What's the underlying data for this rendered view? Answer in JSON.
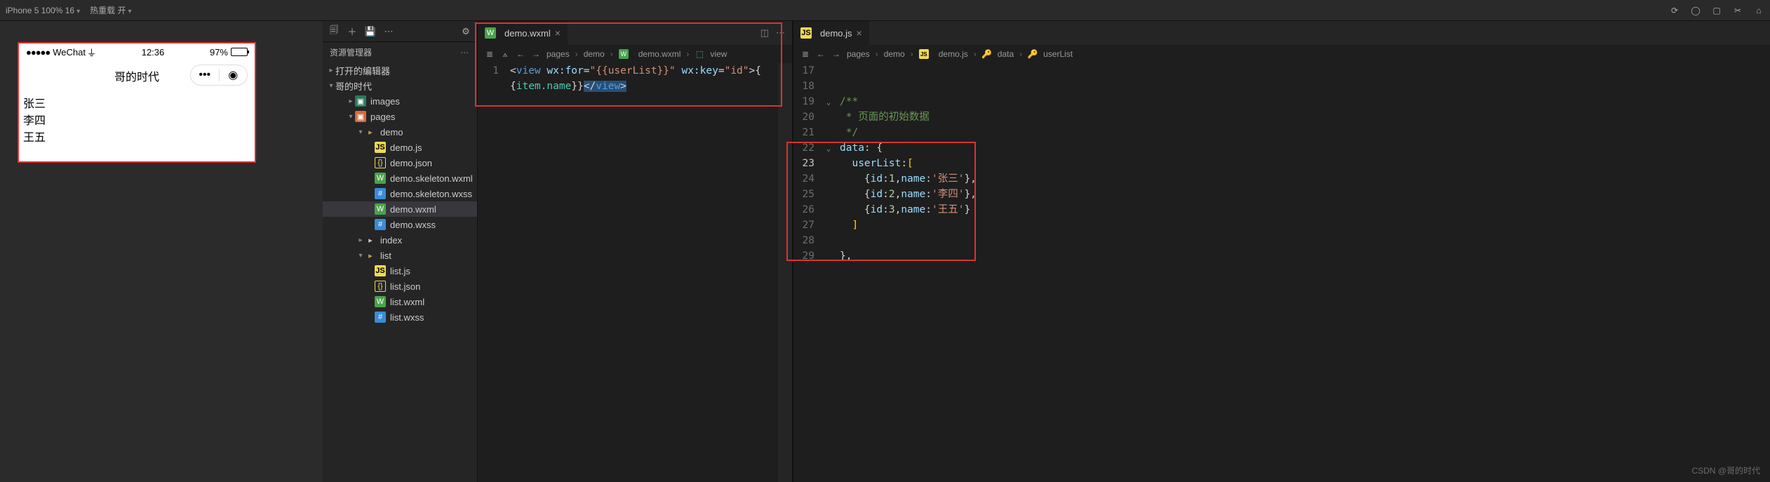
{
  "toolbar": {
    "device": "iPhone 5 100% 16",
    "reload": "热重载 开"
  },
  "simulator": {
    "status_time": "12:36",
    "signal_label": "WeChat",
    "battery_pct": "97%",
    "nav_title": "哥的时代",
    "list": [
      "张三",
      "李四",
      "王五"
    ]
  },
  "explorer": {
    "title": "资源管理器",
    "sections": {
      "open_editors": "打开的编辑器",
      "project": "哥的时代"
    },
    "tree": [
      {
        "name": "images",
        "type": "img",
        "depth": 2,
        "tw": "▸"
      },
      {
        "name": "pages",
        "type": "pages",
        "depth": 2,
        "tw": "▾"
      },
      {
        "name": "demo",
        "type": "dir",
        "depth": 3,
        "tw": "▾"
      },
      {
        "name": "demo.js",
        "type": "js",
        "depth": 4
      },
      {
        "name": "demo.json",
        "type": "json",
        "depth": 4
      },
      {
        "name": "demo.skeleton.wxml",
        "type": "wxml",
        "depth": 4
      },
      {
        "name": "demo.skeleton.wxss",
        "type": "wxss",
        "depth": 4
      },
      {
        "name": "demo.wxml",
        "type": "wxml",
        "depth": 4,
        "selected": true
      },
      {
        "name": "demo.wxss",
        "type": "wxss",
        "depth": 4
      },
      {
        "name": "index",
        "type": "folder",
        "depth": 3,
        "tw": "▸"
      },
      {
        "name": "list",
        "type": "dir",
        "depth": 3,
        "tw": "▾"
      },
      {
        "name": "list.js",
        "type": "js",
        "depth": 4
      },
      {
        "name": "list.json",
        "type": "json",
        "depth": 4
      },
      {
        "name": "list.wxml",
        "type": "wxml",
        "depth": 4
      },
      {
        "name": "list.wxss",
        "type": "wxss",
        "depth": 4
      }
    ]
  },
  "editor_left": {
    "tab": "demo.wxml",
    "breadcrumb": [
      "pages",
      "demo",
      "demo.wxml",
      "view"
    ],
    "code": {
      "line1": {
        "open": "<",
        "tag": "view",
        "sp": " ",
        "a1": "wx:for",
        "eq": "=",
        "v1": "\"{{userList}}\"",
        "a2": "wx:key",
        "v2": "\"id\"",
        "close": ">{"
      },
      "line2": {
        "open": "{",
        "expr": "item.name",
        "mid": "}}",
        "ctag": "</",
        "tag": "view",
        "end": ">"
      }
    }
  },
  "editor_right": {
    "tab": "demo.js",
    "breadcrumb": [
      "pages",
      "demo",
      "demo.js",
      "data",
      "userList"
    ],
    "lines": {
      "l17": "17",
      "l18": "18",
      "l19": "19",
      "l20": "20",
      "l21": "21",
      "l22": "22",
      "l23": "23",
      "l24": "24",
      "l25": "25",
      "l26": "26",
      "l27": "27",
      "l28": "28",
      "l29": "29"
    },
    "code": {
      "c19a": "/**",
      "c20a": " * 页面的初始数据",
      "c21a": " */",
      "c22_key": "data",
      "c22_rest": ": {",
      "c23_key": "userList",
      "c23_rest": ":",
      "c23_br": "[",
      "c24": "{id:1,name:'张三'},",
      "c25": "{id:2,name:'李四'},",
      "c26": "{id:3,name:'王五'}",
      "c27": "]",
      "c29": "},"
    }
  },
  "watermark": "CSDN @哥的时代"
}
